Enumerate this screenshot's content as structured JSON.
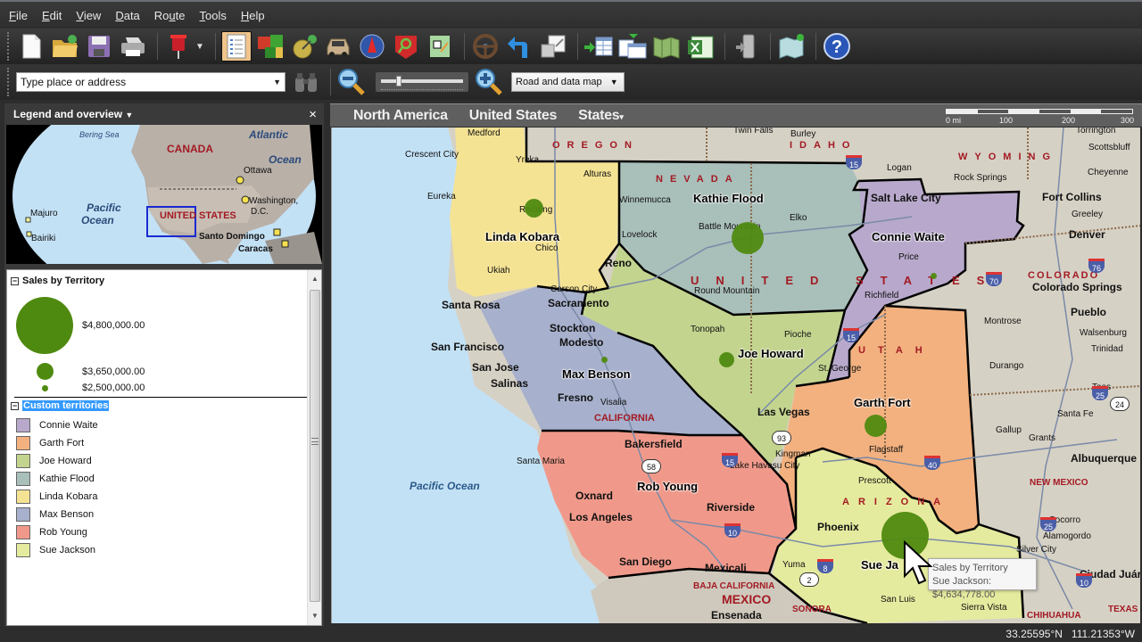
{
  "menu": {
    "items": [
      {
        "label": "File",
        "accel": "F"
      },
      {
        "label": "Edit",
        "accel": "E"
      },
      {
        "label": "View",
        "accel": "V"
      },
      {
        "label": "Data",
        "accel": "D"
      },
      {
        "label": "Route",
        "accel": "u"
      },
      {
        "label": "Tools",
        "accel": "T"
      },
      {
        "label": "Help",
        "accel": "H"
      }
    ]
  },
  "toolbar": {
    "buttons": [
      {
        "name": "new-document",
        "icon": "new-document-icon"
      },
      {
        "name": "open",
        "icon": "open-folder-icon"
      },
      {
        "name": "save",
        "icon": "save-disk-icon"
      },
      {
        "name": "print",
        "icon": "printer-icon"
      },
      {
        "name": "pushpin",
        "icon": "pushpin-icon"
      },
      {
        "name": "legend",
        "icon": "legend-list-icon",
        "active": true
      },
      {
        "name": "territories",
        "icon": "territories-icon"
      },
      {
        "name": "data-mapping",
        "icon": "data-mapping-icon"
      },
      {
        "name": "route",
        "icon": "car-icon"
      },
      {
        "name": "compass",
        "icon": "compass-icon"
      },
      {
        "name": "find-nearby",
        "icon": "find-nearby-icon"
      },
      {
        "name": "map-overview",
        "icon": "map-locator-icon"
      },
      {
        "name": "directions",
        "icon": "steering-wheel-icon"
      },
      {
        "name": "undo",
        "icon": "undo-arrow-icon"
      },
      {
        "name": "export",
        "icon": "export-icon"
      },
      {
        "name": "import-data",
        "icon": "import-data-icon"
      },
      {
        "name": "link-data",
        "icon": "link-data-icon"
      },
      {
        "name": "map-book",
        "icon": "map-book-icon"
      },
      {
        "name": "excel",
        "icon": "excel-icon"
      },
      {
        "name": "send-to-device",
        "icon": "send-to-device-icon"
      },
      {
        "name": "share-map",
        "icon": "share-map-icon"
      },
      {
        "name": "help",
        "icon": "help-icon"
      }
    ]
  },
  "search": {
    "placeholder": "Type place or address",
    "value": ""
  },
  "map_style": {
    "selected": "Road and data map"
  },
  "zoom": {
    "level_fraction": 0.2
  },
  "legend_panel": {
    "title": "Legend and overview",
    "close_label": "×",
    "overview_labels": {
      "bering_sea": "Bering Sea",
      "canada": "CANADA",
      "atlantic": "Atlantic",
      "ocean": "Ocean",
      "ottawa": "Ottawa",
      "washington": "Washington,",
      "dc": "D.C.",
      "pacific": "Pacific",
      "pacific_ocean": "Ocean",
      "majuro": "Majuro",
      "bairiki": "Bairiki",
      "united_states": "UNITED STATES",
      "santo_domingo": "Santo Domingo",
      "caracas": "Caracas"
    },
    "sales_section": {
      "title": "Sales by Territory",
      "entries": [
        {
          "value": "$4,800,000.00"
        },
        {
          "value": "$3,650,000.00"
        },
        {
          "value": "$2,500,000.00"
        }
      ]
    },
    "territories_section": {
      "title": "Custom territories",
      "items": [
        {
          "label": "Connie Waite",
          "color": "#b8a9cc"
        },
        {
          "label": "Garth Fort",
          "color": "#f2b17f"
        },
        {
          "label": "Joe Howard",
          "color": "#c3d48f"
        },
        {
          "label": "Kathie Flood",
          "color": "#a9bfb9"
        },
        {
          "label": "Linda Kobara",
          "color": "#f5e394"
        },
        {
          "label": "Max Benson",
          "color": "#a7b0cc"
        },
        {
          "label": "Rob Young",
          "color": "#f0998a"
        },
        {
          "label": "Sue Jackson",
          "color": "#e5eb9e"
        }
      ]
    }
  },
  "breadcrumb": {
    "items": [
      "North America",
      "United States",
      "States"
    ],
    "last_has_dropdown": true
  },
  "scale": {
    "labels": [
      "0 mi",
      "100",
      "200",
      "300"
    ]
  },
  "map": {
    "territory_labels": {
      "linda_kobara": "Linda Kobara",
      "kathie_flood": "Kathie Flood",
      "connie_waite": "Connie Waite",
      "max_benson": "Max Benson",
      "joe_howard": "Joe Howard",
      "garth_fort": "Garth Fort",
      "rob_young": "Rob Young",
      "sue_jackson": "Sue Ja"
    },
    "state_labels": {
      "oregon": "OREGON",
      "idaho": "IDAHO",
      "wyoming": "WYOMING",
      "nevada": "NEVADA",
      "united_states": "UNITED STATES",
      "utah": "UTAH",
      "colorado": "COLORADO",
      "california": "CALIFORNIA",
      "arizona": "ARIZONA",
      "new_mexico": "NEW MEXICO",
      "baja_california": "BAJA CALIFORNIA",
      "mexico": "MEXICO",
      "sonora": "SONORA",
      "chihuahua": "CHIHUAHUA",
      "texas": "TEXAS"
    },
    "ocean_label": "Pacific Ocean",
    "cities": {
      "medford": "Medford",
      "crescent_city": "Crescent City",
      "yreka": "Yreka",
      "alturas": "Alturas",
      "eureka": "Eureka",
      "redding": "Redding",
      "chico": "Chico",
      "ukiah": "Ukiah",
      "reno": "Reno",
      "carson_city": "Carson City",
      "sacramento": "Sacramento",
      "santa_rosa": "Santa Rosa",
      "twin_falls": "Twin Falls",
      "burley": "Burley",
      "winnemucca": "Winnemucca",
      "elko": "Elko",
      "battle_mountain": "Battle Mountain",
      "lovelock": "Lovelock",
      "round_mountain": "Round Mountain",
      "tonopah": "Tonopah",
      "pioche": "Pioche",
      "st_george": "St. George",
      "las_vegas": "Las Vegas",
      "salt_lake_city": "Salt Lake City",
      "logan": "Logan",
      "price": "Price",
      "richfield": "Richfield",
      "torrington": "Torrington",
      "scottsbluff": "Scottsbluff",
      "rock_springs": "Rock Springs",
      "cheyenne": "Cheyenne",
      "fort_collins": "Fort Collins",
      "greeley": "Greeley",
      "denver": "Denver",
      "colorado_springs": "Colorado Springs",
      "pueblo": "Pueblo",
      "montrose": "Montrose",
      "walsenburg": "Walsenburg",
      "trinidad": "Trinidad",
      "durango": "Durango",
      "taos": "Taos",
      "santa_fe": "Santa Fe",
      "gallup": "Gallup",
      "grants": "Grants",
      "albuquerque": "Albuquerque",
      "stockton": "Stockton",
      "modesto": "Modesto",
      "san_francisco": "San Francisco",
      "san_jose": "San Jose",
      "salinas": "Salinas",
      "fresno": "Fresno",
      "visalia": "Visalia",
      "bakersfield": "Bakersfield",
      "santa_maria": "Santa Maria",
      "oxnard": "Oxnard",
      "los_angeles": "Los Angeles",
      "riverside": "Riverside",
      "san_diego": "San Diego",
      "mexicali": "Mexicali",
      "ensenada": "Ensenada",
      "lake_havasu": "Lake Havasu City",
      "kingman": "Kingman",
      "flagstaff": "Flagstaff",
      "prescott": "Prescott",
      "phoenix": "Phoenix",
      "yuma": "Yuma",
      "san_luis": "San Luis",
      "sierra_vista": "Sierra Vista",
      "silver_city": "Silver City",
      "alamogordo": "Alamogordo",
      "socorro": "Socorro",
      "ciudad_juarez": "Ciudad Juárez"
    },
    "highway_shields": [
      "15",
      "70",
      "76",
      "25",
      "24",
      "93",
      "58",
      "40",
      "10",
      "8",
      "2"
    ],
    "bubble_color": "#4f8a10"
  },
  "tooltip": {
    "line1": "Sales by Territory",
    "line2": "Sue Jackson: $4,634,778.00"
  },
  "status": {
    "latitude": "33.25595°N",
    "longitude": "111.21353°W"
  }
}
